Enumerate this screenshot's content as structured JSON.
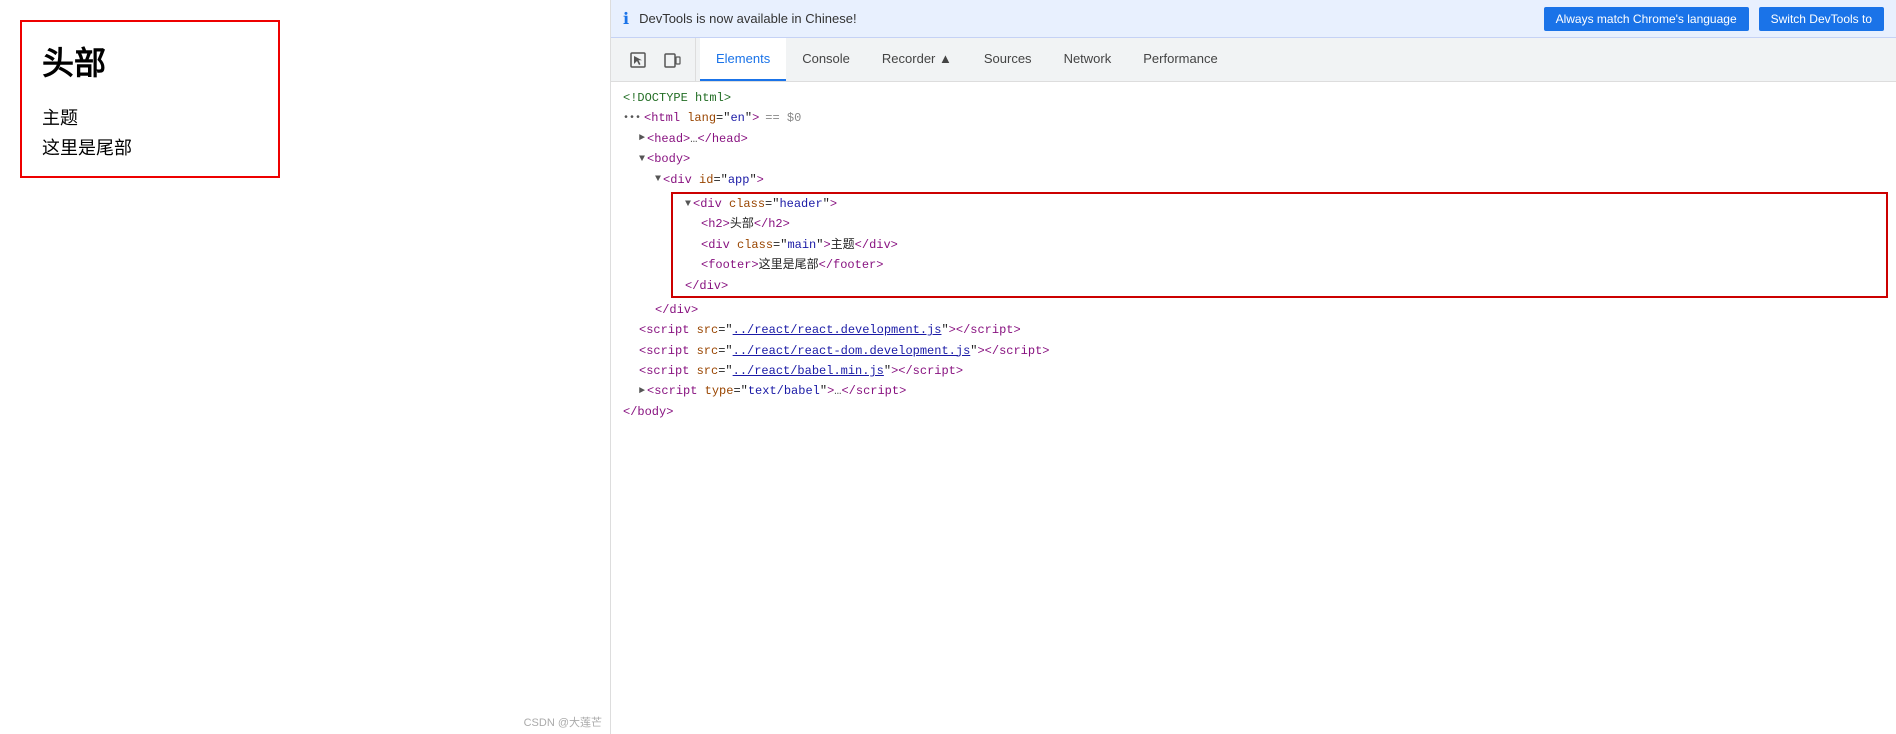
{
  "preview": {
    "heading": "头部",
    "main": "主题",
    "footer": "这里是尾部"
  },
  "notification": {
    "icon": "ℹ",
    "text": "DevTools is now available in Chinese!",
    "btn1": "Always match Chrome's language",
    "btn2": "Switch DevTools to"
  },
  "tabs": {
    "icons": [
      {
        "name": "cursor-icon",
        "symbol": "⬚"
      },
      {
        "name": "device-icon",
        "symbol": "⬒"
      }
    ],
    "items": [
      {
        "label": "Elements",
        "active": true
      },
      {
        "label": "Console",
        "active": false
      },
      {
        "label": "Recorder ▲",
        "active": false
      },
      {
        "label": "Sources",
        "active": false
      },
      {
        "label": "Network",
        "active": false
      },
      {
        "label": "Performance",
        "active": false
      }
    ]
  },
  "dom": {
    "lines": [
      {
        "indent": 0,
        "content": "<!DOCTYPE html>",
        "type": "comment"
      },
      {
        "indent": 0,
        "content": "html_open",
        "type": "html-open"
      },
      {
        "indent": 1,
        "content": "head_collapsed",
        "type": "head"
      },
      {
        "indent": 1,
        "content": "body_open",
        "type": "body"
      },
      {
        "indent": 2,
        "content": "div_app_open",
        "type": "div-app"
      },
      {
        "indent": 3,
        "content": "div_header_open",
        "type": "div-header",
        "highlighted": true
      },
      {
        "indent": 4,
        "content": "h2_line",
        "type": "h2",
        "highlighted": true
      },
      {
        "indent": 4,
        "content": "div_main_line",
        "type": "div-main",
        "highlighted": true
      },
      {
        "indent": 4,
        "content": "footer_line",
        "type": "footer-line",
        "highlighted": true
      },
      {
        "indent": 3,
        "content": "div_close",
        "type": "div-close",
        "highlighted": true
      },
      {
        "indent": 2,
        "content": "div_app_close",
        "type": "div-app-close"
      },
      {
        "indent": 1,
        "content": "script1",
        "type": "script"
      },
      {
        "indent": 1,
        "content": "script2",
        "type": "script"
      },
      {
        "indent": 1,
        "content": "script3",
        "type": "script"
      },
      {
        "indent": 1,
        "content": "script4",
        "type": "script"
      },
      {
        "indent": 0,
        "content": "body_close",
        "type": "body-close"
      }
    ]
  },
  "watermark": "CSDN @大莲芒"
}
